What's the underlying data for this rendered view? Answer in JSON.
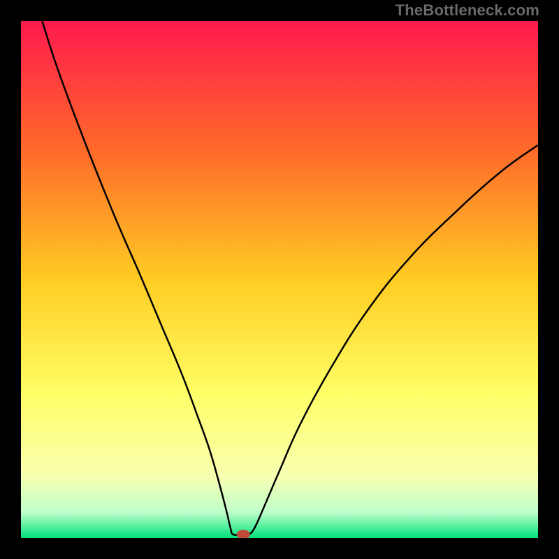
{
  "attribution": "TheBottleneck.com",
  "chart_data": {
    "type": "line",
    "title": "",
    "xlabel": "",
    "ylabel": "",
    "xlim": [
      0,
      100
    ],
    "ylim": [
      0,
      100
    ],
    "background_gradient": {
      "stops": [
        {
          "offset": 0,
          "color": "#ff1a4d"
        },
        {
          "offset": 25,
          "color": "#ff6a2a"
        },
        {
          "offset": 50,
          "color": "#ffcc22"
        },
        {
          "offset": 72,
          "color": "#ffff66"
        },
        {
          "offset": 88,
          "color": "#f8ffb0"
        },
        {
          "offset": 95,
          "color": "#c0ffcc"
        },
        {
          "offset": 100,
          "color": "#00e37a"
        }
      ]
    },
    "series": [
      {
        "name": "bottleneck-curve",
        "stroke": "#000000",
        "stroke_width": 2.5,
        "points": [
          {
            "x": 4.1,
            "y": 100.0
          },
          {
            "x": 7.0,
            "y": 91.0
          },
          {
            "x": 12.0,
            "y": 77.5
          },
          {
            "x": 18.0,
            "y": 62.5
          },
          {
            "x": 23.0,
            "y": 51.0
          },
          {
            "x": 27.0,
            "y": 41.5
          },
          {
            "x": 31.0,
            "y": 32.0
          },
          {
            "x": 34.0,
            "y": 24.0
          },
          {
            "x": 36.5,
            "y": 17.0
          },
          {
            "x": 38.5,
            "y": 10.0
          },
          {
            "x": 39.8,
            "y": 5.0
          },
          {
            "x": 40.5,
            "y": 2.0
          },
          {
            "x": 41.0,
            "y": 0.7
          },
          {
            "x": 42.5,
            "y": 0.7
          },
          {
            "x": 44.0,
            "y": 0.7
          },
          {
            "x": 45.2,
            "y": 2.0
          },
          {
            "x": 47.0,
            "y": 6.0
          },
          {
            "x": 50.0,
            "y": 13.0
          },
          {
            "x": 54.0,
            "y": 22.0
          },
          {
            "x": 60.0,
            "y": 33.0
          },
          {
            "x": 67.0,
            "y": 44.0
          },
          {
            "x": 75.0,
            "y": 54.0
          },
          {
            "x": 84.0,
            "y": 63.0
          },
          {
            "x": 93.0,
            "y": 71.0
          },
          {
            "x": 100.0,
            "y": 76.0
          }
        ]
      }
    ],
    "marker": {
      "name": "min-marker",
      "x": 43.0,
      "y": 0.7,
      "rx": 1.3,
      "ry": 0.9,
      "fill": "#c24a3a"
    }
  }
}
